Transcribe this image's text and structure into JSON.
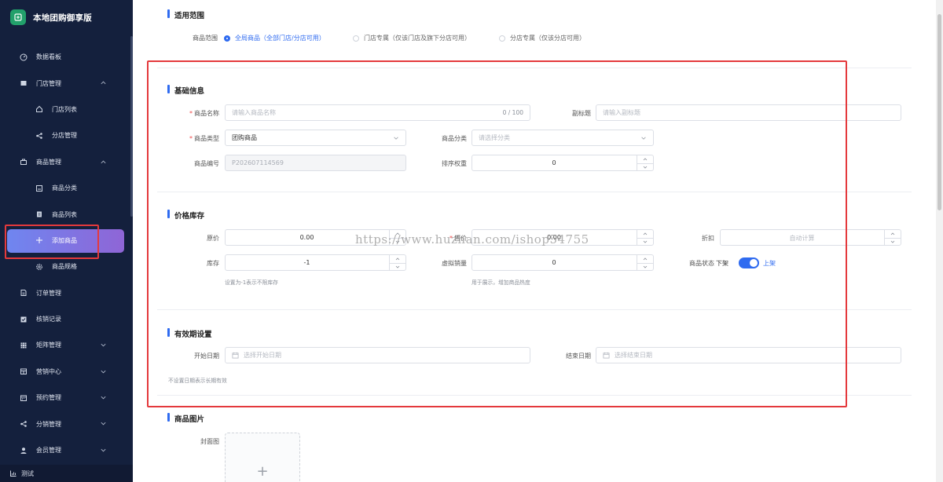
{
  "sidebar": {
    "brand_title": "本地团购御享版",
    "menu": [
      {
        "label": "数据看板",
        "icon": "dashboard-icon",
        "level": 1
      },
      {
        "label": "门店管理",
        "icon": "store-icon",
        "level": 1,
        "expanded": true
      },
      {
        "label": "门店列表",
        "icon": "home-icon",
        "level": 2
      },
      {
        "label": "分店管理",
        "icon": "share-icon",
        "level": 2
      },
      {
        "label": "商品管理",
        "icon": "bag-icon",
        "level": 1,
        "expanded": true
      },
      {
        "label": "商品分类",
        "icon": "category-icon",
        "level": 2
      },
      {
        "label": "商品列表",
        "icon": "list-icon",
        "level": 2
      },
      {
        "label": "添加商品",
        "icon": "plus-icon",
        "level": 2,
        "active": true
      },
      {
        "label": "商品规格",
        "icon": "gear-icon",
        "level": 2
      },
      {
        "label": "订单管理",
        "icon": "order-icon",
        "level": 1
      },
      {
        "label": "核销记录",
        "icon": "check-icon",
        "level": 1
      },
      {
        "label": "矩阵管理",
        "icon": "grid-icon",
        "level": 1,
        "expandable": true
      },
      {
        "label": "营销中心",
        "icon": "shop-icon",
        "level": 1,
        "expandable": true
      },
      {
        "label": "预约管理",
        "icon": "calendar-icon",
        "level": 1,
        "expandable": true
      },
      {
        "label": "分销管理",
        "icon": "share-icon",
        "level": 1,
        "expandable": true
      },
      {
        "label": "会员管理",
        "icon": "user-icon",
        "level": 1,
        "expandable": true
      }
    ],
    "footer_label": "测试"
  },
  "scope": {
    "title": "适用范围",
    "label": "商品范围",
    "options": [
      {
        "label": "全局商品（全部门店/分店可用）",
        "selected": true
      },
      {
        "label": "门店专属（仅该门店及旗下分店可用）",
        "selected": false
      },
      {
        "label": "分店专属（仅该分店可用）",
        "selected": false
      }
    ]
  },
  "basic": {
    "title": "基础信息",
    "name_label": "商品名称",
    "name_placeholder": "请输入商品名称",
    "name_counter": "0 / 100",
    "subtitle_label": "副标题",
    "subtitle_placeholder": "请输入副标题",
    "type_label": "商品类型",
    "type_value": "团购商品",
    "category_label": "商品分类",
    "category_placeholder": "请选择分类",
    "code_label": "商品编号",
    "code_value": "P202607114569",
    "sort_label": "排序权重",
    "sort_value": "0"
  },
  "price": {
    "title": "价格库存",
    "original_label": "原价",
    "original_value": "0.00",
    "sale_label": "售价",
    "sale_value": "0.00",
    "discount_label": "折扣",
    "discount_placeholder": "自动计算",
    "stock_label": "库存",
    "stock_value": "-1",
    "stock_hint": "设置为-1表示不限库存",
    "virtual_label": "虚拟销量",
    "virtual_value": "0",
    "virtual_hint": "用于展示，增加商品热度",
    "status_label": "商品状态",
    "status_off": "下架",
    "status_on": "上架",
    "status_enabled": true
  },
  "validity": {
    "title": "有效期设置",
    "start_label": "开始日期",
    "start_placeholder": "选择开始日期",
    "end_label": "结束日期",
    "end_placeholder": "选择结束日期",
    "hint": "不设置日期表示长期有效"
  },
  "images": {
    "title": "商品图片",
    "cover_label": "封面图"
  },
  "watermark": "https://www.huzhan.com/ishop54755",
  "colors": {
    "sidebar_bg": "#14203d",
    "accent": "#2f6bf0",
    "active_gradient_start": "#6f86f0",
    "active_gradient_end": "#8f65d6",
    "highlight_box": "#e4393c"
  }
}
